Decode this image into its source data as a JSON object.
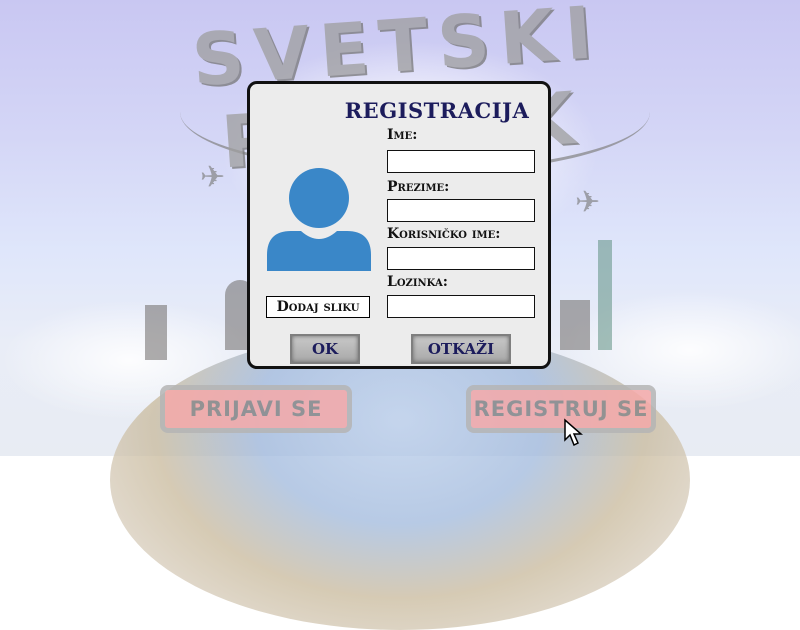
{
  "game": {
    "title": "SVETSKI PUTNIK"
  },
  "menu": {
    "login_label": "PRIJAVI SE",
    "register_label": "REGISTRUJ SE"
  },
  "dialog": {
    "title": "REGISTRACIJA",
    "add_photo_label": "Dodaj sliku",
    "fields": [
      {
        "label": "Ime:",
        "value": ""
      },
      {
        "label": "Prezime:",
        "value": ""
      },
      {
        "label": "Korisničko ime:",
        "value": ""
      },
      {
        "label": "Lozinka:",
        "value": ""
      }
    ],
    "ok_label": "OK",
    "cancel_label": "OTKAŽI"
  },
  "colors": {
    "dialog_title": "#1c1c5c",
    "avatar": "#3a87c8",
    "button_pink": "#f5a9a9"
  },
  "icons": {
    "avatar": "user-avatar-icon",
    "cursor": "mouse-pointer-icon",
    "planes": "airplane-icon"
  }
}
